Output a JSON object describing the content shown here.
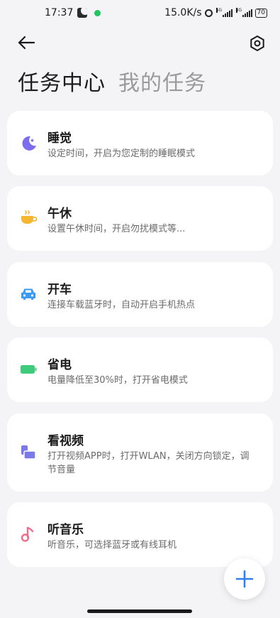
{
  "status_bar": {
    "time": "17:37",
    "network_speed": "15.0K/s",
    "signal_1_label": "5G",
    "signal_2_label": "4G",
    "battery": "70"
  },
  "header": {
    "back_icon": "arrow-left-icon",
    "settings_icon": "hexagon-gear-icon"
  },
  "tabs": [
    {
      "label": "任务中心",
      "active": true
    },
    {
      "label": "我的任务",
      "active": false
    }
  ],
  "tasks": [
    {
      "title": "睡觉",
      "desc": "设定时间，开启为您定制的睡眠模式",
      "icon": "moon-icon",
      "color": "#7b6cf0"
    },
    {
      "title": "午休",
      "desc": "设置午休时间，开启勿扰模式等...",
      "icon": "coffee-cup-icon",
      "color": "#f5b731"
    },
    {
      "title": "开车",
      "desc": "连接车载蓝牙时，自动开启手机热点",
      "icon": "car-icon",
      "color": "#3b9bf0"
    },
    {
      "title": "省电",
      "desc": "电量降低至30%时，打开省电模式",
      "icon": "battery-icon",
      "color": "#3ecb7a"
    },
    {
      "title": "看视频",
      "desc": "打开视频APP时，打开WLAN，关闭方向锁定，调节音量",
      "icon": "video-rotate-icon",
      "color": "#7a7ae8"
    },
    {
      "title": "听音乐",
      "desc": "听音乐，可选择蓝牙或有线耳机",
      "icon": "music-note-icon",
      "color": "#f06a8e"
    }
  ],
  "fab": {
    "icon": "plus-icon",
    "color": "#2f80ed"
  }
}
